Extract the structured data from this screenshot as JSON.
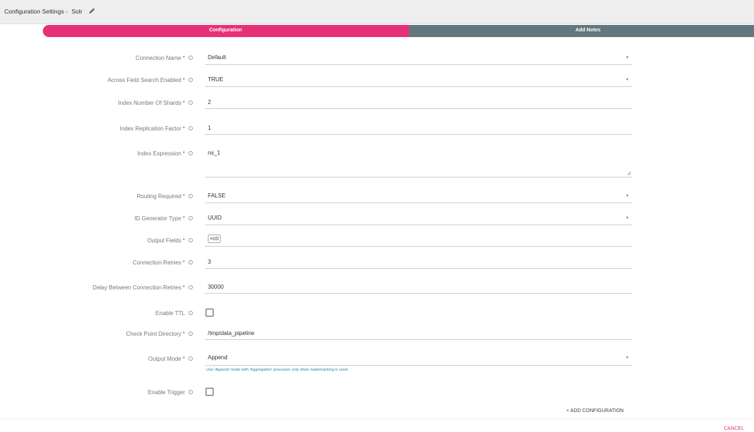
{
  "header": {
    "title": "Configuration Settings -",
    "subtitle": "Solr"
  },
  "steps": [
    {
      "label": "Configuration",
      "active": true,
      "color": "#e7307a"
    },
    {
      "label": "Add Notes",
      "active": false,
      "color": "#62787f"
    }
  ],
  "form": {
    "connection_name": {
      "label": "Connection Name",
      "required": true,
      "value": "Default"
    },
    "across_field_search": {
      "label": "Across Field Search Enabled",
      "required": true,
      "value": "TRUE"
    },
    "index_number_of_shards": {
      "label": "Index Number Of Shards",
      "required": true,
      "value": "2"
    },
    "index_replication_factor": {
      "label": "Index Replication Factor",
      "required": true,
      "value": "1"
    },
    "index_expression": {
      "label": "Index Expression",
      "required": true,
      "value": "ns_1"
    },
    "routing_required": {
      "label": "Routing Required",
      "required": true,
      "value": "FALSE"
    },
    "id_generator_type": {
      "label": "ID Generator Type",
      "required": true,
      "value": "UUID"
    },
    "output_fields": {
      "label": "Output Fields",
      "required": true,
      "chips": [
        "c0"
      ]
    },
    "connection_retries": {
      "label": "Connection Retries",
      "required": true,
      "value": "3"
    },
    "delay_between_retries": {
      "label": "Delay Between Connection Retries",
      "required": true,
      "value": "30000"
    },
    "enable_ttl": {
      "label": "Enable TTL",
      "required": false,
      "checked": false
    },
    "check_point_directory": {
      "label": "Check Point Directory",
      "required": true,
      "value": "/tmp/data_pipeline"
    },
    "output_mode": {
      "label": "Output Mode",
      "required": true,
      "value": "Append",
      "hint": "Use 'Append' mode with 'Aggregation' processor only when watermarking is used."
    },
    "enable_trigger": {
      "label": "Enable Trigger",
      "required": false,
      "checked": false
    }
  },
  "actions": {
    "add_configuration": "+ ADD CONFIGURATION",
    "cancel": "CANCEL"
  },
  "colors": {
    "accent": "#e7307a",
    "step_inactive": "#62787f",
    "hint": "#1e8da4"
  }
}
